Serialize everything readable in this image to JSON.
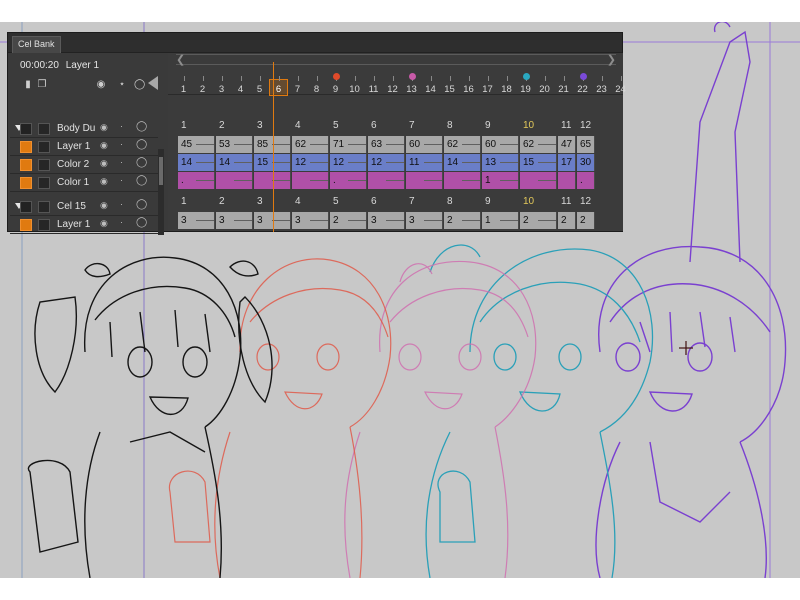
{
  "window": {
    "tab_label": "Cel Bank",
    "timecode": "00:00:20",
    "current_layer": "Layer 1"
  },
  "layers": [
    {
      "name": "Body Du",
      "type": "folder",
      "swatch": "#222222"
    },
    {
      "name": "Layer 1",
      "type": "layer",
      "swatch": "#e07a10"
    },
    {
      "name": "Color 2",
      "type": "layer",
      "swatch": "#e07a10"
    },
    {
      "name": "Color 1",
      "type": "layer",
      "swatch": "#e07a10"
    },
    {
      "name": "Cel 15",
      "type": "folder",
      "swatch": "#222222"
    },
    {
      "name": "Layer 1",
      "type": "layer",
      "swatch": "#e07a10"
    }
  ],
  "timeline": {
    "frames": [
      "1",
      "2",
      "3",
      "4",
      "5",
      "6",
      "7",
      "8",
      "9",
      "10",
      "11",
      "12",
      "13",
      "14",
      "15",
      "16",
      "17",
      "18",
      "19",
      "20",
      "21",
      "22",
      "23",
      "24"
    ],
    "current_frame": 6,
    "markers": [
      {
        "frame": 9,
        "color": "#e04a2a"
      },
      {
        "frame": 13,
        "color": "#c85aa8"
      },
      {
        "frame": 19,
        "color": "#2aa8c0"
      },
      {
        "frame": 22,
        "color": "#7a4ad8"
      }
    ]
  },
  "group1": {
    "header": [
      "1",
      "2",
      "3",
      "4",
      "5",
      "6",
      "7",
      "8",
      "9",
      "10",
      "11",
      "12"
    ],
    "rows": [
      {
        "name": "Layer 1",
        "color": "#a8a8a8",
        "cells": [
          "45",
          "53",
          "85",
          "62",
          "71",
          "63",
          "60",
          "62",
          "60",
          "62",
          "47",
          "65"
        ]
      },
      {
        "name": "Color 2",
        "color": "#6a7ec8",
        "cells": [
          "14",
          "14",
          "15",
          "12",
          "12",
          "12",
          "11",
          "14",
          "13",
          "15",
          "17",
          "30"
        ]
      },
      {
        "name": "Color 1",
        "color": "#b050a8",
        "cells": [
          ".",
          "",
          "",
          "",
          ".",
          "",
          "",
          "",
          "1",
          "",
          "",
          "."
        ]
      }
    ]
  },
  "group2": {
    "header": [
      "1",
      "2",
      "3",
      "4",
      "5",
      "6",
      "7",
      "8",
      "9",
      "10",
      "11",
      "12"
    ],
    "rows": [
      {
        "name": "Layer 1",
        "color": "#a8a8a8",
        "cells": [
          "3",
          "3",
          "3",
          "3",
          "2",
          "3",
          "3",
          "2",
          "1",
          "2",
          "2",
          "2"
        ]
      }
    ]
  },
  "colors": {
    "accent": "#e07a10",
    "panel_bg": "#3a3a3a",
    "canvas_bg": "#c8c8c8"
  }
}
